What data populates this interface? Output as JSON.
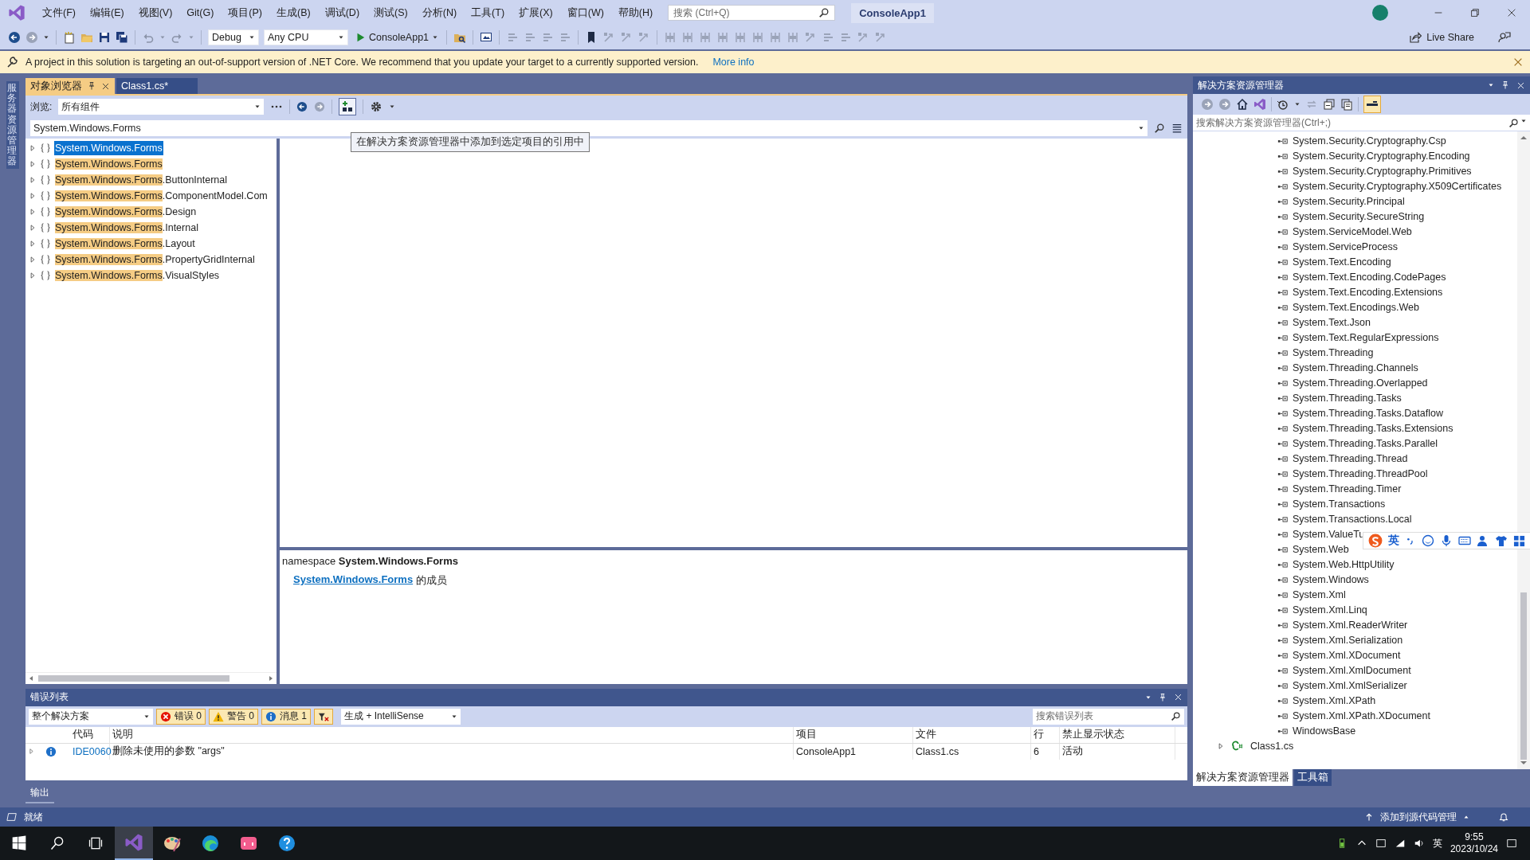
{
  "window": {
    "title": "ConsoleApp1",
    "search_placeholder": "搜索 (Ctrl+Q)"
  },
  "menu": [
    "文件(F)",
    "编辑(E)",
    "视图(V)",
    "Git(G)",
    "项目(P)",
    "生成(B)",
    "调试(D)",
    "测试(S)",
    "分析(N)",
    "工具(T)",
    "扩展(X)",
    "窗口(W)",
    "帮助(H)"
  ],
  "toolbar": {
    "configuration": "Debug",
    "platform": "Any CPU",
    "start": "ConsoleApp1",
    "live_share": "Live Share"
  },
  "info_bar": {
    "message": "A project in this solution is targeting an out-of-support version of .NET Core. We recommend that you update your target to a currently supported version.",
    "link": "More info"
  },
  "side_tabs": [
    "服务器资源管理器"
  ],
  "document_tabs": [
    {
      "label": "对象浏览器",
      "selected": true
    },
    {
      "label": "Class1.cs*",
      "selected": false
    }
  ],
  "object_browser": {
    "browse_label": "浏览:",
    "browse_value": "所有组件",
    "search_value": "System.Windows.Forms",
    "tooltip": "在解决方案资源管理器中添加到选定项目的引用中",
    "tree": [
      {
        "match": "System.Windows.Forms",
        "selected": true
      },
      {
        "match": "System.Windows.Forms",
        "selected": false
      },
      {
        "match": "System.Windows.Forms",
        "rest": ".ButtonInternal",
        "selected": false
      },
      {
        "match": "System.Windows.Forms",
        "rest": ".ComponentModel.Com",
        "selected": false
      },
      {
        "match": "System.Windows.Forms",
        "rest": ".Design",
        "selected": false
      },
      {
        "match": "System.Windows.Forms",
        "rest": ".Internal",
        "selected": false
      },
      {
        "match": "System.Windows.Forms",
        "rest": ".Layout",
        "selected": false
      },
      {
        "match": "System.Windows.Forms",
        "rest": ".PropertyGridInternal",
        "selected": false
      },
      {
        "match": "System.Windows.Forms",
        "rest": ".VisualStyles",
        "selected": false
      }
    ],
    "description": {
      "declaration": "namespace **System.Windows.Forms**",
      "member_link": "System.Windows.Forms",
      "member_suffix": "的成员"
    }
  },
  "error_list": {
    "title": "错误列表",
    "scope": "整个解决方案",
    "filters": [
      {
        "kind": "error",
        "label": "错误 0",
        "selected": true
      },
      {
        "kind": "warning",
        "label": "警告 0",
        "selected": true
      },
      {
        "kind": "message",
        "label": "消息 1",
        "selected": true
      }
    ],
    "source": "生成 + IntelliSense",
    "search_placeholder": "搜索错误列表",
    "columns": [
      "代码",
      "说明",
      "项目",
      "文件",
      "行",
      "禁止显示状态"
    ],
    "rows": [
      {
        "kind": "info",
        "code": "IDE0060",
        "description": "删除未使用的参数 \"args\"",
        "project": "ConsoleApp1",
        "file": "Class1.cs",
        "line": "6",
        "state": "活动"
      }
    ]
  },
  "output_tab": "输出",
  "status_bar": {
    "text": "就绪",
    "source_control": "添加到源代码管理"
  },
  "solution_explorer": {
    "title": "解决方案资源管理器",
    "search_placeholder": "搜索解决方案资源管理器(Ctrl+;)",
    "references": [
      "System.Security.Cryptography.Csp",
      "System.Security.Cryptography.Encoding",
      "System.Security.Cryptography.Primitives",
      "System.Security.Cryptography.X509Certificates",
      "System.Security.Principal",
      "System.Security.SecureString",
      "System.ServiceModel.Web",
      "System.ServiceProcess",
      "System.Text.Encoding",
      "System.Text.Encoding.CodePages",
      "System.Text.Encoding.Extensions",
      "System.Text.Encodings.Web",
      "System.Text.Json",
      "System.Text.RegularExpressions",
      "System.Threading",
      "System.Threading.Channels",
      "System.Threading.Overlapped",
      "System.Threading.Tasks",
      "System.Threading.Tasks.Dataflow",
      "System.Threading.Tasks.Extensions",
      "System.Threading.Tasks.Parallel",
      "System.Threading.Thread",
      "System.Threading.ThreadPool",
      "System.Threading.Timer",
      "System.Transactions",
      "System.Transactions.Local",
      "System.ValueTu",
      "System.Web",
      "System.Web.HttpUtility",
      "System.Windows",
      "System.Xml",
      "System.Xml.Linq",
      "System.Xml.ReaderWriter",
      "System.Xml.Serialization",
      "System.Xml.XDocument",
      "System.Xml.XmlDocument",
      "System.Xml.XmlSerializer",
      "System.Xml.XPath",
      "System.Xml.XPath.XDocument",
      "WindowsBase"
    ],
    "files": [
      {
        "name": "Class1.cs",
        "expanded": false
      }
    ],
    "tabs": [
      {
        "label": "解决方案资源管理器",
        "selected": true
      },
      {
        "label": "工具箱",
        "selected": false
      }
    ]
  },
  "ime_bar": {
    "language": "英"
  },
  "taskbar": {
    "apps": [
      {
        "kind": "visual-studio",
        "selected": true
      },
      {
        "kind": "paint",
        "selected": false
      },
      {
        "kind": "edge",
        "selected": false
      },
      {
        "kind": "video",
        "selected": false
      },
      {
        "kind": "help",
        "selected": false
      }
    ],
    "tray_language": "英",
    "time": "9:55",
    "date": "2023/10/24"
  }
}
